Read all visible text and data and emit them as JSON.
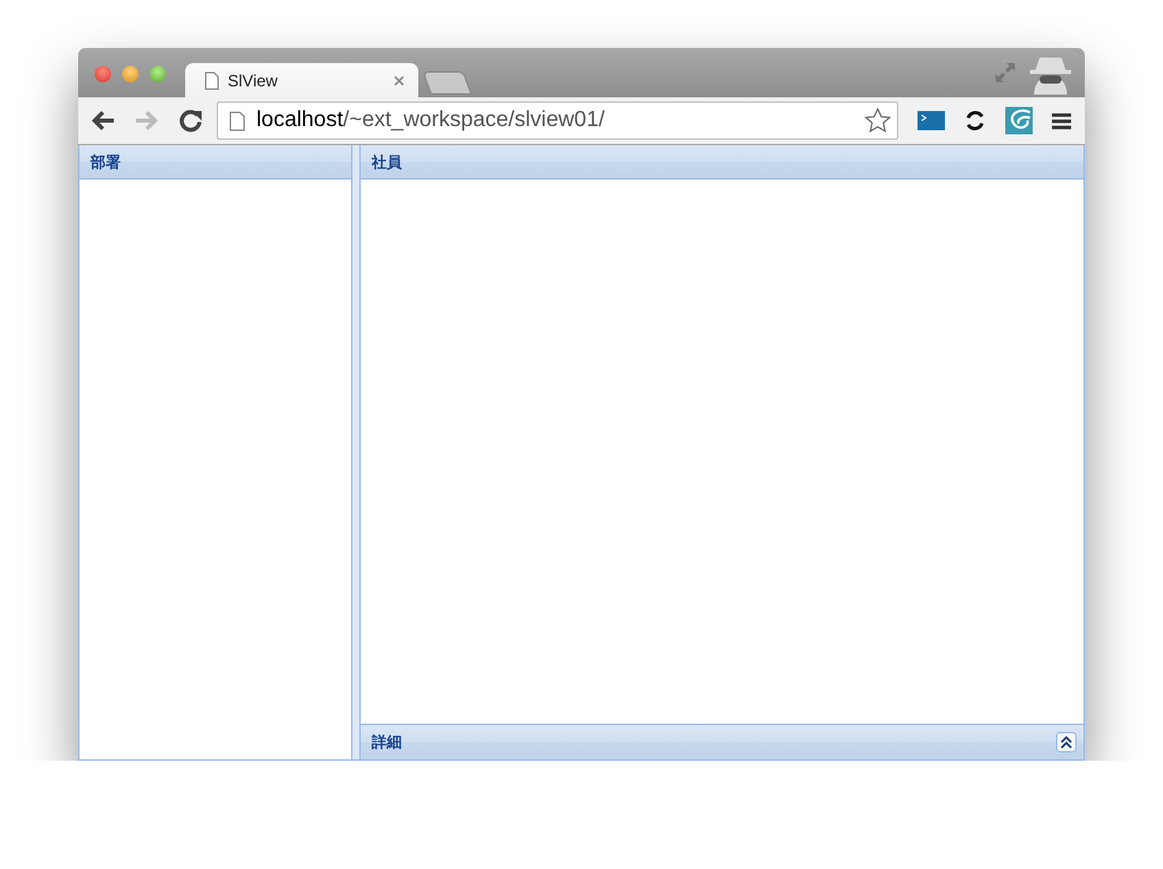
{
  "browser": {
    "tabs": [
      {
        "title": "SlView",
        "selected": true
      }
    ],
    "url": {
      "host": "localhost",
      "path": "/~ext_workspace/slview01/"
    }
  },
  "panels": {
    "left": {
      "title": "部署"
    },
    "main": {
      "title": "社員"
    },
    "detail": {
      "title": "詳細",
      "collapsed": true
    }
  }
}
